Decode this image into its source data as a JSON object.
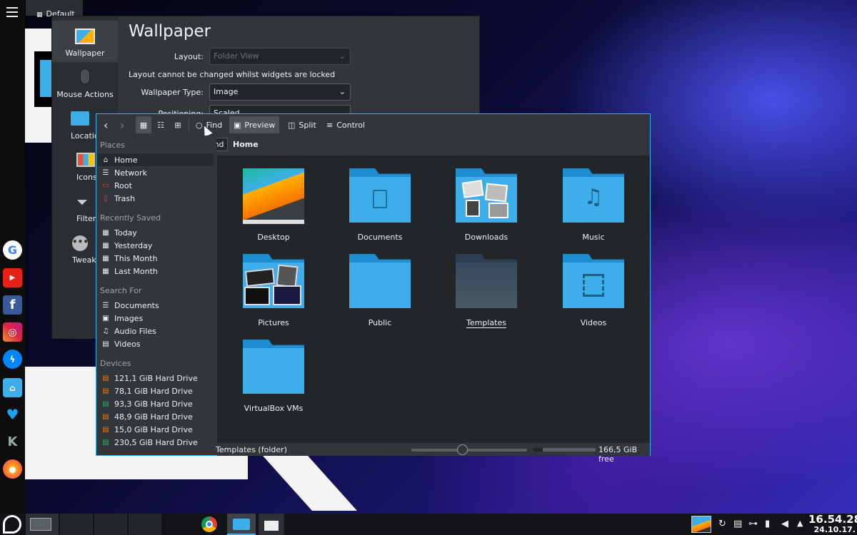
{
  "settings": {
    "tab_label": "Default",
    "title": "Wallpaper",
    "sidebar": [
      {
        "label": "Wallpaper",
        "icon": "wallpaper-icon"
      },
      {
        "label": "Mouse Actions",
        "icon": "mouse-icon"
      },
      {
        "label": "Location",
        "icon": "folder-icon"
      },
      {
        "label": "Icons",
        "icon": "icons-icon"
      },
      {
        "label": "Filter",
        "icon": "filter-icon"
      },
      {
        "label": "Tweak",
        "icon": "tweak-icon"
      }
    ],
    "layout_label": "Layout:",
    "layout_value": "Folder View",
    "locked_note": "Layout cannot be changed whilst widgets are locked",
    "wallpaper_type_label": "Wallpaper Type:",
    "wallpaper_type_value": "Image",
    "positioning_label": "Positioning:",
    "positioning_value": "Scaled"
  },
  "dolphin": {
    "toolbar": {
      "back": "‹",
      "forward": "›",
      "find": "Find",
      "preview": "Preview",
      "split": "Split",
      "control": "Control"
    },
    "tooltip": "Find",
    "breadcrumb": "Home",
    "places": {
      "title": "Places",
      "items": [
        "Home",
        "Network",
        "Root",
        "Trash"
      ]
    },
    "recent": {
      "title": "Recently Saved",
      "items": [
        "Today",
        "Yesterday",
        "This Month",
        "Last Month"
      ]
    },
    "search": {
      "title": "Search For",
      "items": [
        "Documents",
        "Images",
        "Audio Files",
        "Videos"
      ]
    },
    "devices": {
      "title": "Devices",
      "items": [
        "121,1 GiB Hard Drive",
        "78,1 GiB Hard Drive",
        "93,3 GiB Hard Drive",
        "48,9 GiB Hard Drive",
        "15,0 GiB Hard Drive",
        "230,5 GiB Hard Drive"
      ]
    },
    "folders": [
      "Desktop",
      "Documents",
      "Downloads",
      "Music",
      "Pictures",
      "Public",
      "Templates",
      "Videos",
      "VirtualBox VMs"
    ],
    "status_text": "Templates (folder)",
    "free_space": "166,5 GiB free",
    "used_fraction": 0.16
  },
  "launcher": {
    "apps": [
      "google-icon",
      "youtube-icon",
      "facebook-icon",
      "instagram-icon",
      "messenger-icon",
      "home-folder-icon",
      "twitter-icon",
      "kde-icon",
      "firefox-icon"
    ]
  },
  "tray": {
    "time": "16.54.28",
    "date": "24.10.17."
  },
  "colors": {
    "accent": "#3daee9",
    "folder": "#3daee9",
    "window_bg": "#31363b",
    "view_bg": "#232629"
  }
}
